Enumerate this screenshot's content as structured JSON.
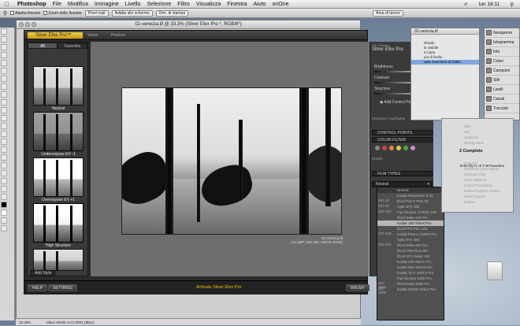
{
  "menubar": {
    "app": "Photoshop",
    "items": [
      "File",
      "Modifica",
      "Immagine",
      "Livello",
      "Selezione",
      "Filtro",
      "Visualizza",
      "Finestra",
      "Aiuto",
      "onOne"
    ],
    "clock": "lun 16:11"
  },
  "options_bar": {
    "check1": "Adatta finestre",
    "check2": "Zoom delle finestre",
    "btn1": "Pixel reali",
    "btn2": "Adatta allo schermo",
    "btn3": "Dim. di stampa",
    "workspace": "Area di lavoro"
  },
  "document": {
    "title": "02-venezia.tif @ 33,3% (Silver Efex Pro *, RGB/8*)",
    "zoom": "33.33%",
    "profile": "Nikon sRGB 4.0.0.3001 (8bpc)"
  },
  "plugin": {
    "name": "Silver Efex Pro™",
    "tabs": [
      "All",
      "Favorites"
    ],
    "preview_label": "Preview",
    "view_label": "Views",
    "presets": [
      {
        "label": "Neutral"
      },
      {
        "label": "Underexpose EV -1"
      },
      {
        "label": "Overexpose EV +1"
      },
      {
        "label": "High Structure"
      }
    ],
    "add_style": "Add Style",
    "image_name": "02-venezia.tif",
    "image_meta": "(12.1MP, ISO 200, NIKON D700)",
    "buttons": {
      "help": "HELP",
      "settings": "SETTINGS",
      "activate": "Activate Silver Efex Pro",
      "brush": "BRUSH"
    }
  },
  "controls": {
    "brand_top": "Nik Software",
    "brand": "Silver Efex Pro",
    "sliders": [
      {
        "label": "Brightness",
        "value": "0%"
      },
      {
        "label": "Contrast",
        "value": "0%"
      },
      {
        "label": "Structure",
        "value": "0%"
      }
    ],
    "add_cp": "Add Control Point",
    "shadows": "Shadows / Highlights",
    "sections": [
      "CONTROL POINTS",
      "COLOR FILTER",
      "FILM TYPES"
    ],
    "details": "Details",
    "film_value": "Neutral"
  },
  "film_list": {
    "items": [
      {
        "iso": "",
        "name": "Neutral"
      },
      {
        "iso": "ISO 32",
        "name": "Kodak Panatomic X 32"
      },
      {
        "iso": "ISO 50",
        "name": "Ilford Pan F Plus 50"
      },
      {
        "iso": "ISO 100",
        "name": "Agfa APX 100"
      },
      {
        "iso": "",
        "name": "Fuji Neopan ACROS 100"
      },
      {
        "iso": "",
        "name": "Ilford Delta 100 Pro"
      },
      {
        "iso": "",
        "name": "Kodak 100 TMAX Pro"
      },
      {
        "iso": "ISO 125",
        "name": "Ilford FP4 Plus 125"
      },
      {
        "iso": "",
        "name": "Kodak Plus-X 125PX Pro"
      },
      {
        "iso": "ISO 400",
        "name": "Agfa APX 400"
      },
      {
        "iso": "",
        "name": "Ilford Delta 400 Pro"
      },
      {
        "iso": "",
        "name": "Ilford HP5 Plus 400"
      },
      {
        "iso": "",
        "name": "Ilford XP2 Super 400"
      },
      {
        "iso": "",
        "name": "Kodak 400 TMAX Pro"
      },
      {
        "iso": "",
        "name": "Kodak BW 400CN Pro"
      },
      {
        "iso": "",
        "name": "Kodak Tri-X 400TX Pro"
      },
      {
        "iso": "ISO 1600",
        "name": "Fuji Neopan 1600 Pro"
      },
      {
        "iso": "ISO 3200",
        "name": "Ilford Delta 3200 Pro"
      },
      {
        "iso": "",
        "name": "Kodak P3200 TMAX Pro"
      }
    ],
    "selected_index": 6
  },
  "layers_panel": {
    "title": "02-venezia.tif",
    "rows": [
      "sfondo",
      "la visibile",
      "li copia",
      "pia di livello",
      "opia maschera di livello"
    ],
    "highlight_index": 4
  },
  "side_panels": [
    "Navigatore",
    "Istogramma",
    "Info",
    "Colori",
    "Campioni",
    "Stili",
    "Livelli",
    "Canali",
    "Tracciati"
  ],
  "bw_panel": {
    "heading": "2 Complete",
    "items_top": [
      "Skin",
      "Sky",
      "Shadows",
      "Strong Neon"
    ],
    "tabs": [
      "B-Dc",
      "Dy-I",
      "L-S",
      "T-W",
      "Favorites"
    ],
    "items_bottom": [
      "Colorize",
      "Selective Color Range",
      "Contrast Only",
      "Color Balance",
      "Cross Processing",
      "Darken/Lighten Center",
      "Detail Stylizer",
      "Duplex"
    ]
  },
  "desktop": {
    "drive_label": ""
  }
}
